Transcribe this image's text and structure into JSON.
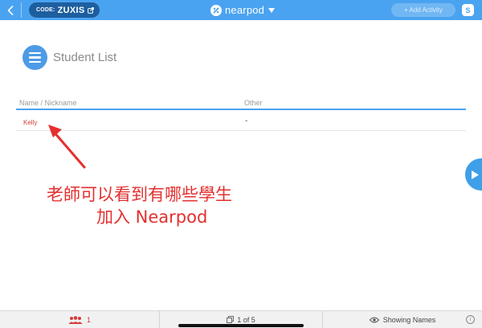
{
  "topbar": {
    "code_label": "CODE:",
    "code_value": "ZUXIS",
    "logo_text": "nearpod",
    "add_activity_label": "+ Add Activity",
    "student_badge": "S"
  },
  "header": {
    "title": "Student List"
  },
  "table": {
    "columns": [
      "Name / Nickname",
      "Other"
    ],
    "rows": [
      {
        "name": "Kelly",
        "other": "-"
      }
    ]
  },
  "annotation": {
    "line1": "老師可以看到有哪些學生",
    "line2": "加入 Nearpod"
  },
  "bottombar": {
    "student_count": "1",
    "pager_text": "1 of 5",
    "names_label": "Showing Names",
    "info_label": "i"
  },
  "colors": {
    "accent": "#4aa3f0",
    "code_pill": "#1d5f9e",
    "annotation": "#e3302f",
    "student_name": "#d63b3b"
  },
  "icons": [
    "back-icon",
    "external-link-icon",
    "nearpod-logo-icon",
    "chevron-down-icon",
    "list-icon",
    "play-icon",
    "students-icon",
    "slides-icon",
    "eye-icon",
    "info-icon"
  ]
}
